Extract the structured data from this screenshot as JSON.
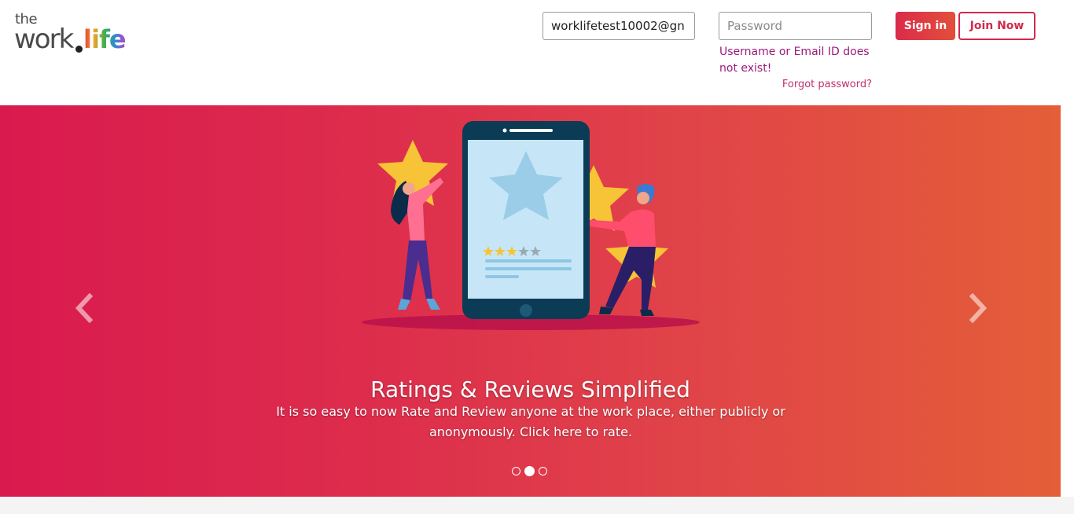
{
  "logo": {
    "the": "the",
    "work": "work",
    "life": "life"
  },
  "login": {
    "email_value": "worklifetest10002@gn",
    "password_placeholder": "Password",
    "error": "Username or Email ID does not exist!",
    "forgot": "Forgot password?",
    "signin_label": "Sign in",
    "join_label": "Join Now"
  },
  "carousel": {
    "title": "Ratings & Reviews Simplified",
    "text": "It is so easy to now Rate and Review anyone at the work place, either publicly or anonymously. Click here to rate.",
    "slide_count": 3,
    "active_slide": 2
  },
  "colors": {
    "brand": "#d91a4e",
    "accent_orange": "#e45e38",
    "error": "#9b1a7a",
    "star": "#f6c436"
  }
}
